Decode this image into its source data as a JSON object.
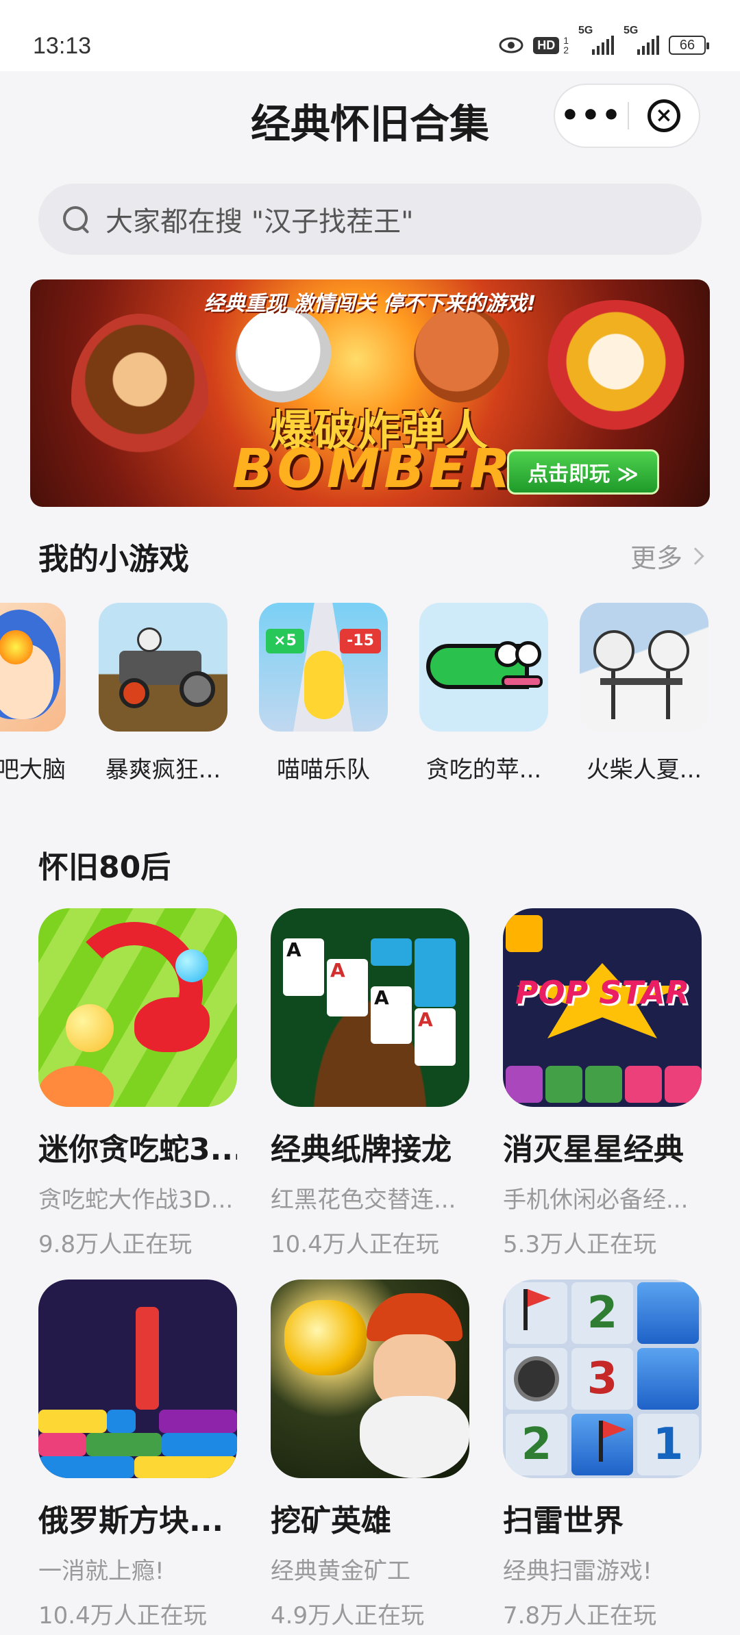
{
  "status": {
    "time": "13:13",
    "hd": "HD",
    "sig1": "5G",
    "sig2": "5G",
    "battery": "66",
    "sim_sup": "1",
    "sim_sub": "2"
  },
  "header": {
    "title": "经典怀旧合集",
    "more_glyph": "•••",
    "close_glyph": "×"
  },
  "search": {
    "placeholder": "大家都在搜 \"汉子找茬王\""
  },
  "banner": {
    "tagline": "经典重现 激情闯关 停不下来的游戏!",
    "title": "爆破炸弹人",
    "subtitle": "BOMBER",
    "cta": "点击即玩 ≫"
  },
  "my_games": {
    "heading": "我的小游戏",
    "more": "更多",
    "items": [
      {
        "label": "吧大脑"
      },
      {
        "label": "暴爽疯狂..."
      },
      {
        "label": "喵喵乐队"
      },
      {
        "label": "贪吃的苹..."
      },
      {
        "label": "火柴人夏..."
      }
    ],
    "tag_left": "×5",
    "tag_right": "-15"
  },
  "retro": {
    "heading": "怀旧80后",
    "games": [
      {
        "name": "迷你贪吃蛇3...",
        "desc": "贪吃蛇大作战3D...",
        "plays": "9.8万人正在玩"
      },
      {
        "name": "经典纸牌接龙",
        "desc": "红黑花色交替连...",
        "plays": "10.4万人正在玩"
      },
      {
        "name": "消灭星星经典",
        "desc": "手机休闲必备经...",
        "plays": "5.3万人正在玩"
      },
      {
        "name": "俄罗斯方块...",
        "desc": "一消就上瘾!",
        "plays": "10.4万人正在玩"
      },
      {
        "name": "挖矿英雄",
        "desc": "经典黄金矿工",
        "plays": "4.9万人正在玩"
      },
      {
        "name": "扫雷世界",
        "desc": "经典扫雷游戏!",
        "plays": "7.8万人正在玩"
      }
    ],
    "popstar_logo": "POP STAR",
    "cards": [
      "A",
      "A",
      "A",
      "A"
    ],
    "mines": [
      "2",
      "3",
      "2",
      "1"
    ]
  }
}
